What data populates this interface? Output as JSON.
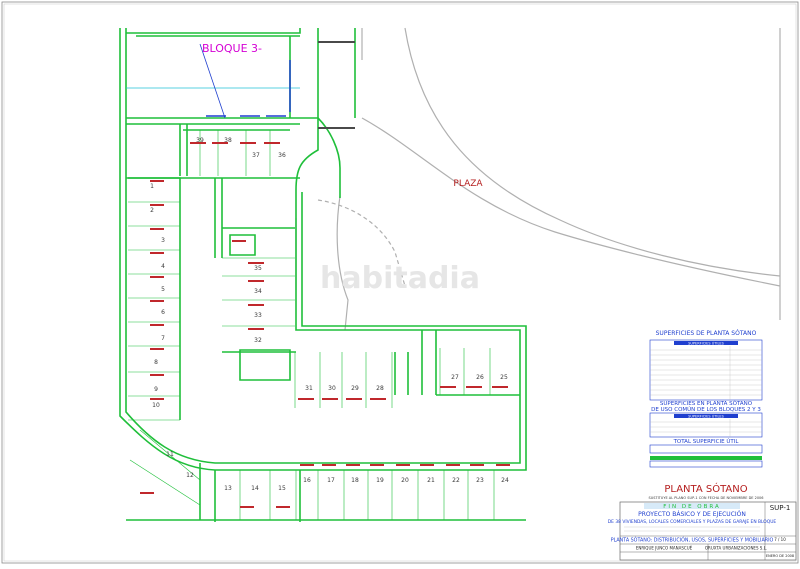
{
  "colors": {
    "wall": "#1fbf3a",
    "label_red": "#c0282c",
    "magenta": "#d400d4",
    "blue": "#1f3fcf",
    "cyan": "#22c3d6",
    "gray": "#b0b0b0",
    "title_red": "#b51f1f"
  },
  "plan": {
    "block_title": "BLOQUE 3-",
    "plaza_label": "PLAZA",
    "watermark": "habitadia",
    "spaces": [
      "39",
      "38",
      "37",
      "36",
      "35",
      "34",
      "33",
      "32",
      "31",
      "30",
      "29",
      "28",
      "27",
      "26",
      "25",
      "24",
      "23",
      "22",
      "21",
      "20",
      "19",
      "18",
      "17",
      "16",
      "15",
      "14",
      "13",
      "12",
      "11",
      "10",
      "9",
      "8",
      "7",
      "6",
      "5",
      "4",
      "3",
      "2",
      "1"
    ]
  },
  "tables": {
    "main_title": "SUPERFICIES DE PLANTA SÓTANO",
    "utiles_title": "SUPERFICIES ÚTILES",
    "common_title_1": "SUPERFICIES EN PLANTA SÓTANO",
    "common_title_2": "DE USO COMÚN DE LOS BLOQUES 2 Y 3",
    "total_utiles_title": "SUPERFICIES ÚTILES",
    "total_title": "TOTAL SUPERFICIE ÚTIL"
  },
  "title_block": {
    "big_title": "PLANTA SÓTANO",
    "note": "SUSTITUYE AL PLANO SUP-1 CON FECHA DE NOVIEMBRE DE 2006",
    "stage": "FIN DE OBRA",
    "project_1": "PROYECTO BÁSICO Y DE EJECUCIÓN",
    "project_2": "DE 38 VIVIENDAS, LOCALES COMERCIALES Y PLAZAS DE GARAJE EN BLOQUE",
    "sheet_code": "SUP-1",
    "sheet_number": "7 / 10",
    "subtitle": "PLANTA SÓTANO: DISTRIBUCIÓN, USOS, SUPERFICIES Y MOBILIARIO",
    "architect": "ENRIQUE JUNCO MANASCUÉ",
    "developer": "ORUXTA URBANIZACIONES S.L.",
    "date": "ENERO DE 2008"
  }
}
